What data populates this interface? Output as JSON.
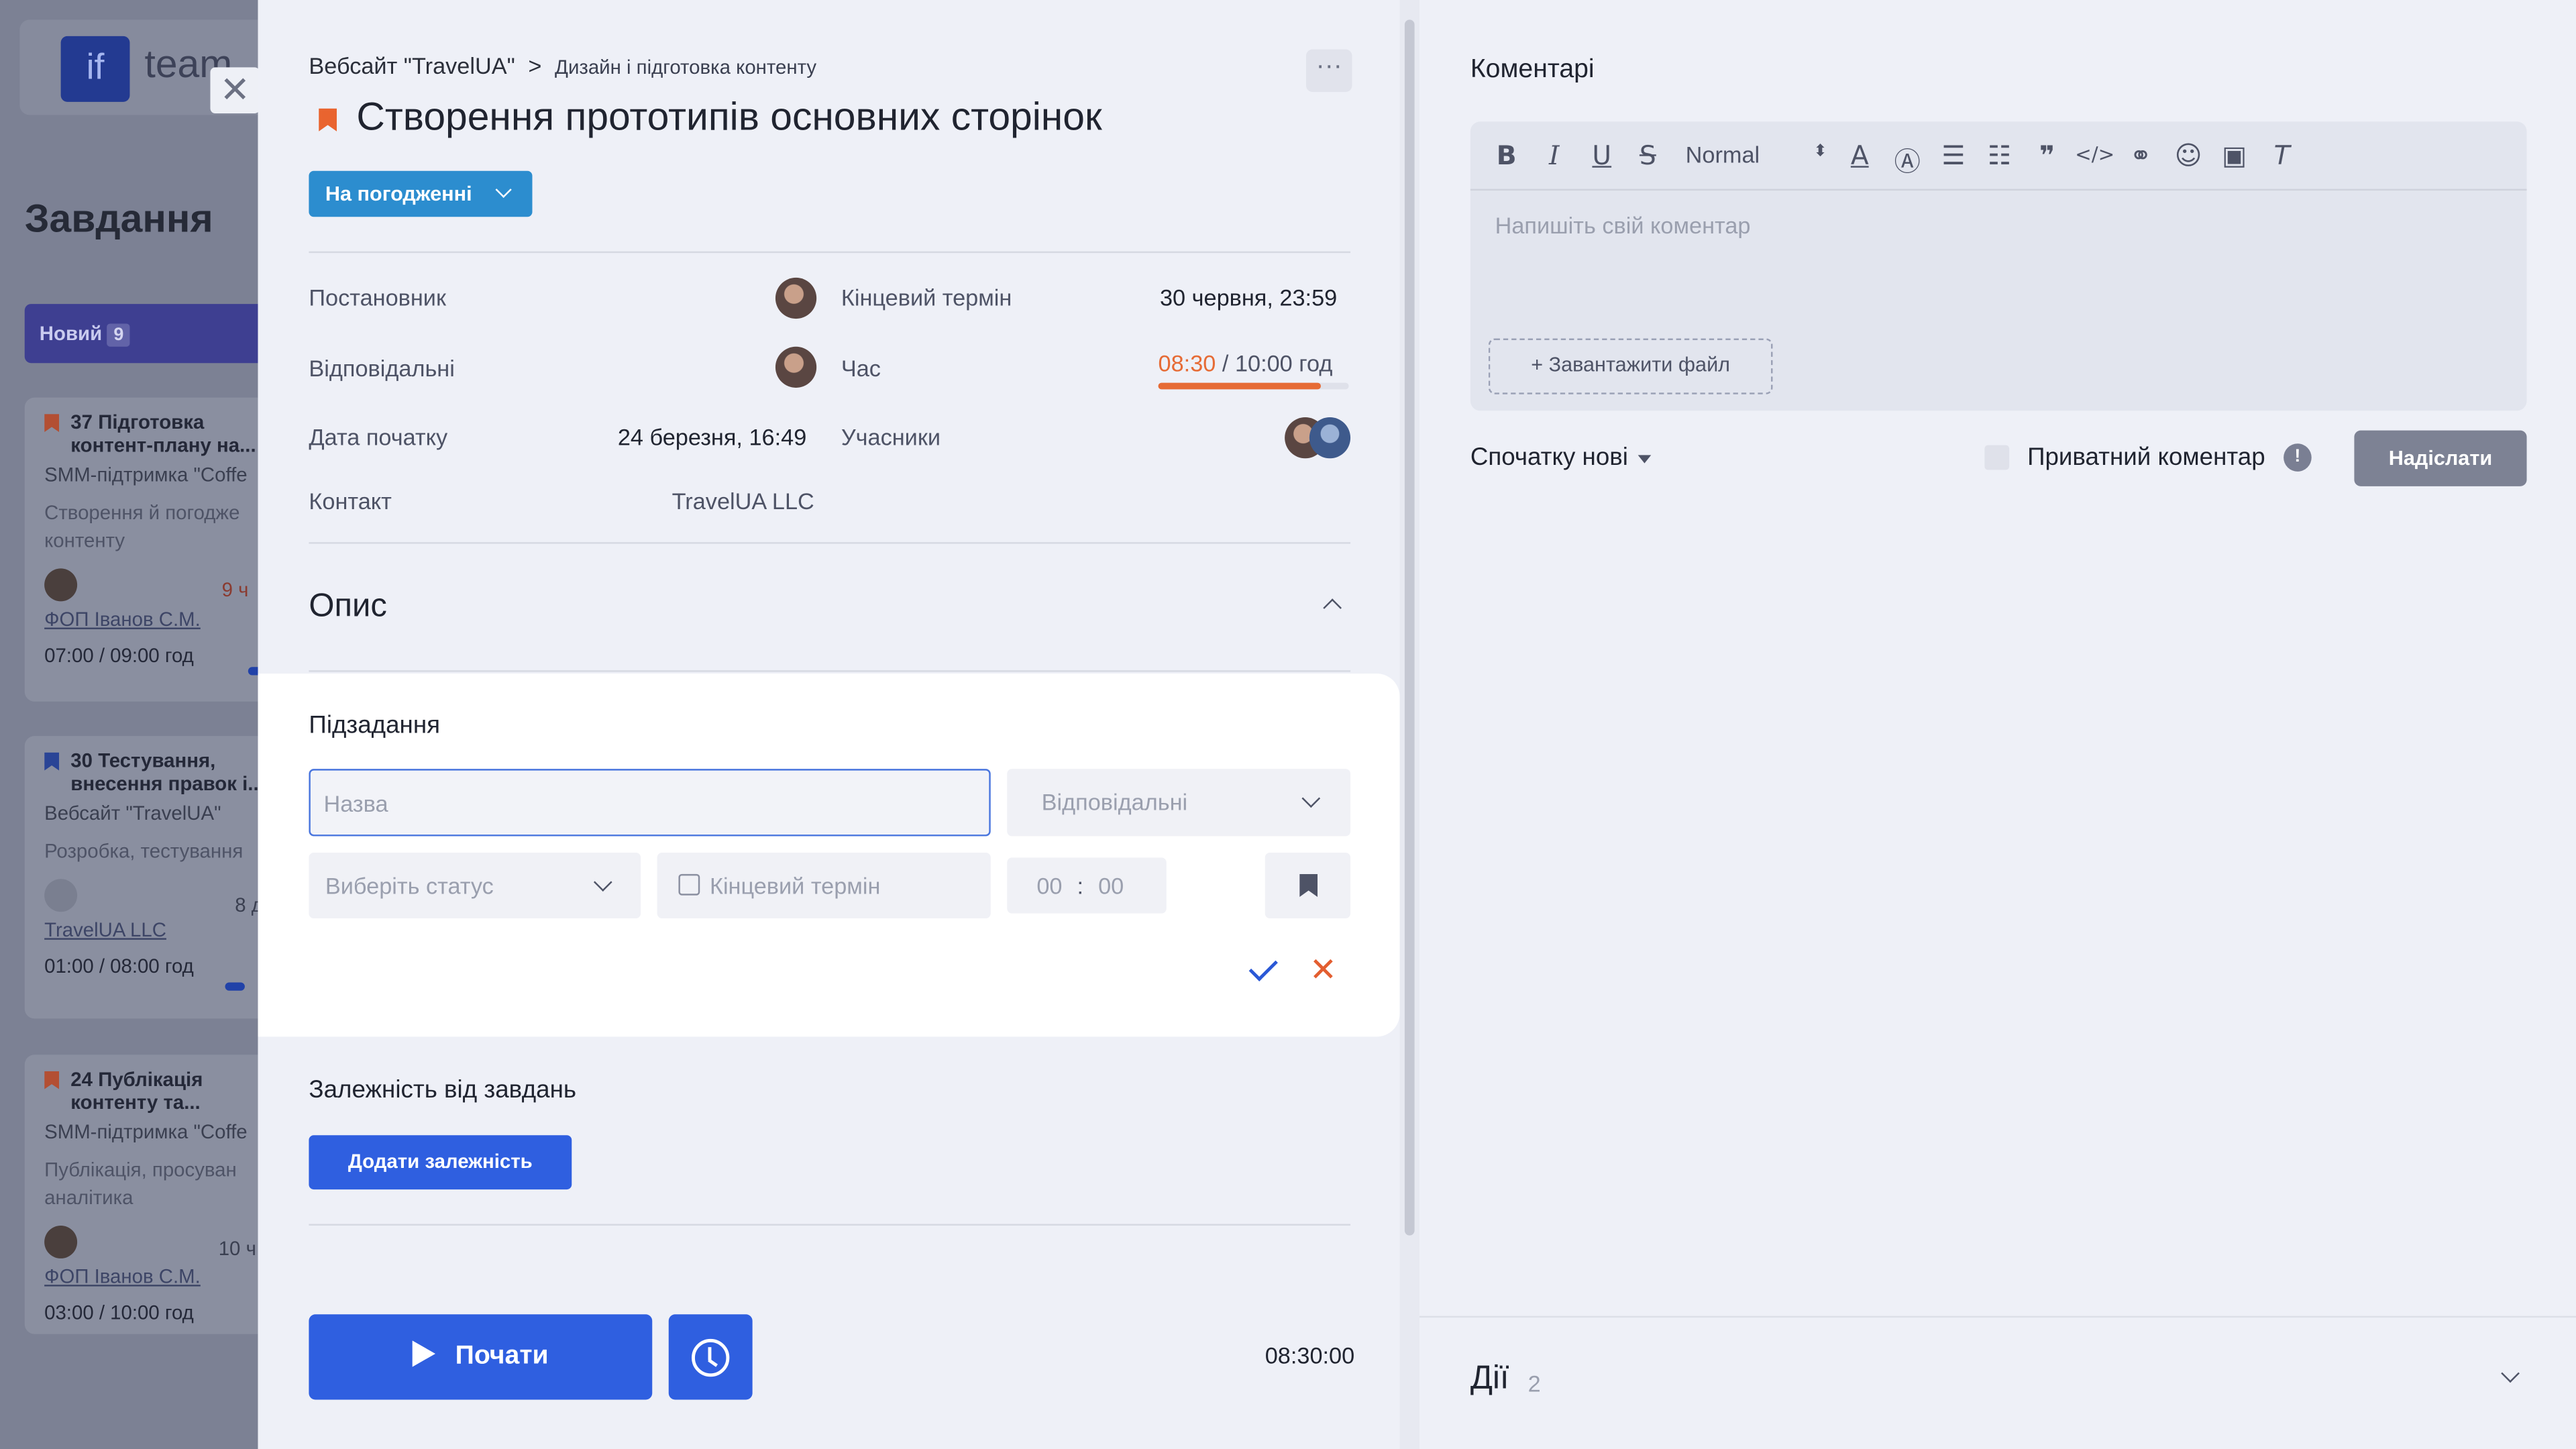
{
  "background": {
    "logo_text": "if",
    "brand_text": "team",
    "page_title": "Завдання",
    "tab_new": {
      "label": "Новий",
      "count": "9"
    },
    "cards": [
      {
        "num": "37",
        "title": "Підготовка контент-плану на...",
        "project": "SMM-підтримка \"Coffe",
        "desc": "Створення й погодже контенту",
        "late": "9 ч",
        "contact": "ФОП Іванов С.М.",
        "time": "07:00 / 09:00 год"
      },
      {
        "num": "30",
        "title": "Тестування, внесення правок і...",
        "project": "Вебсайт \"TravelUA\"",
        "desc": "Розробка, тестування",
        "late": "8 д",
        "contact": "TravelUA LLC",
        "time": "01:00 / 08:00 год"
      },
      {
        "num": "24",
        "title": "Публікація контенту та...",
        "project": "SMM-підтримка \"Coffe",
        "desc": "Публікація, просуван аналітика",
        "late": "10 ч",
        "contact": "ФОП Іванов С.М.",
        "time": "03:00 / 10:00 год"
      }
    ]
  },
  "task": {
    "breadcrumb_project": "Вебсайт \"TravelUA\"",
    "breadcrumb_sep": ">",
    "breadcrumb_stage": "Дизайн і підготовка контенту",
    "more": "···",
    "title": "Створення прототипів основних сторінок",
    "status": "На погодженні",
    "fields": {
      "author_label": "Постановник",
      "deadline_label": "Кінцевий термін",
      "deadline_value": "30 червня, 23:59",
      "responsible_label": "Відповідальні",
      "time_label": "Час",
      "time_spent": "08:30",
      "time_total": "/ 10:00 год",
      "time_progress": 0.85,
      "start_label": "Дата початку",
      "start_value": "24 березня, 16:49",
      "participants_label": "Учасники",
      "contact_label": "Контакт",
      "contact_value": "TravelUA LLC"
    },
    "description_heading": "Опис",
    "subtasks": {
      "heading": "Підзадання",
      "name_placeholder": "Назва",
      "responsible_placeholder": "Відповідальні",
      "status_placeholder": "Виберіть статус",
      "deadline_placeholder": "Кінцевий термін",
      "hours": "00",
      "minutes": "00",
      "time_sep": ":"
    },
    "dependencies": {
      "heading": "Залежність від завдань",
      "add_button": "Додати залежність"
    },
    "start_button": "Почати",
    "timer": "08:30:00"
  },
  "comments": {
    "heading": "Коментарі",
    "format_select": "Normal",
    "placeholder": "Напишіть свій коментар",
    "upload": "+ Завантажити файл",
    "sort": "Спочатку нові",
    "private_label": "Приватний коментар",
    "info": "!",
    "send": "Надіслати"
  },
  "actions": {
    "heading": "Дії",
    "count": "2"
  },
  "colors": {
    "accent": "#2f5fe0",
    "status": "#2c8dcf",
    "flag": "#e9642f",
    "time_spent": "#e66b35"
  }
}
